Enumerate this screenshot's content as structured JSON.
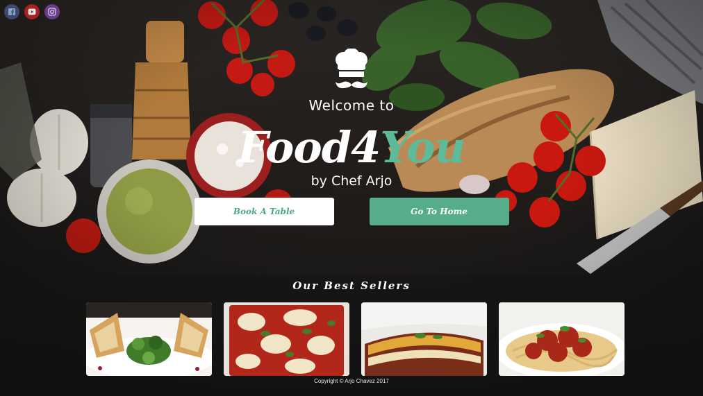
{
  "social": [
    {
      "name": "facebook",
      "icon": "facebook-icon"
    },
    {
      "name": "youtube",
      "icon": "youtube-icon"
    },
    {
      "name": "instagram",
      "icon": "instagram-icon"
    }
  ],
  "hero": {
    "logo_icon": "chef-hat-mustache-icon",
    "welcome": "Welcome to",
    "brand_part1": "Food4",
    "brand_part2": "You",
    "byline": "by Chef Arjo",
    "buttons": {
      "book": "Book A Table",
      "home": "Go To Home"
    }
  },
  "best_sellers": {
    "title": "Our Best Sellers",
    "items": [
      {
        "name": "spring-rolls-salad"
      },
      {
        "name": "pizza"
      },
      {
        "name": "lasagna"
      },
      {
        "name": "spaghetti-meatballs"
      }
    ]
  },
  "footer": {
    "copyright": "Copyright © Arjo Chavez 2017"
  },
  "colors": {
    "accent": "#56ad8c",
    "brand_green": "#5dbb99",
    "white": "#ffffff",
    "facebook": "#3a4a6e",
    "youtube": "#a42222",
    "instagram": "#6a3f8a"
  }
}
